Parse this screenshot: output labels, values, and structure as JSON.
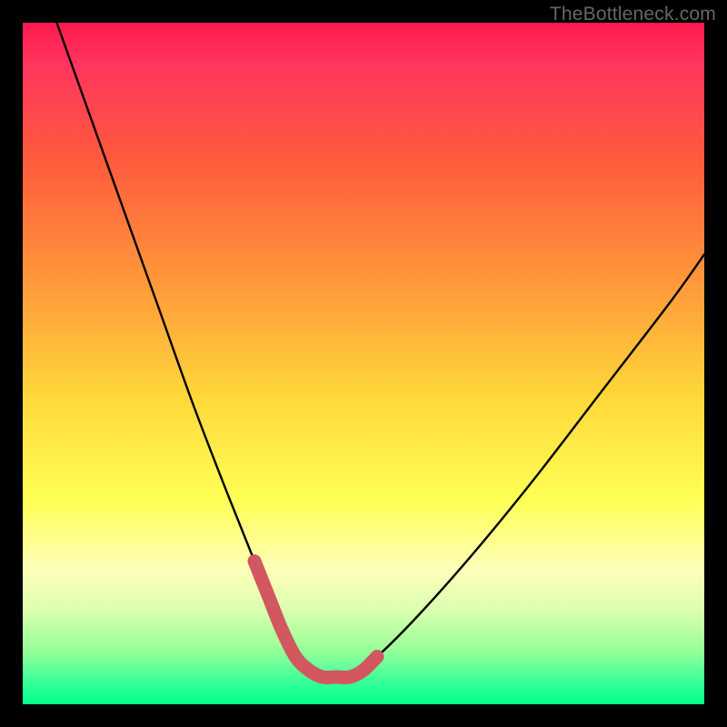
{
  "watermark": "TheBottleneck.com",
  "chart_data": {
    "type": "line",
    "title": "",
    "xlabel": "",
    "ylabel": "",
    "xlim": [
      0,
      100
    ],
    "ylim": [
      0,
      100
    ],
    "series": [
      {
        "name": "bottleneck-curve",
        "x": [
          5,
          10,
          15,
          20,
          25,
          30,
          34,
          37,
          39,
          41,
          43,
          45,
          48,
          52,
          58,
          66,
          75,
          85,
          95,
          100
        ],
        "values": [
          100,
          86,
          72,
          58,
          44,
          31,
          21,
          14,
          9,
          6,
          4,
          4,
          4,
          7,
          13,
          22,
          33,
          46,
          59,
          66
        ]
      }
    ],
    "highlight": {
      "name": "minimum-region",
      "x": [
        34,
        36,
        38,
        40,
        42,
        44,
        46,
        48,
        50,
        52
      ],
      "values": [
        21,
        16,
        11,
        7,
        5,
        4,
        4,
        4,
        5,
        7
      ],
      "color": "#d2575f"
    },
    "background_gradient": {
      "top_color": "#ff1a4d",
      "bottom_color": "#00ff88"
    }
  }
}
